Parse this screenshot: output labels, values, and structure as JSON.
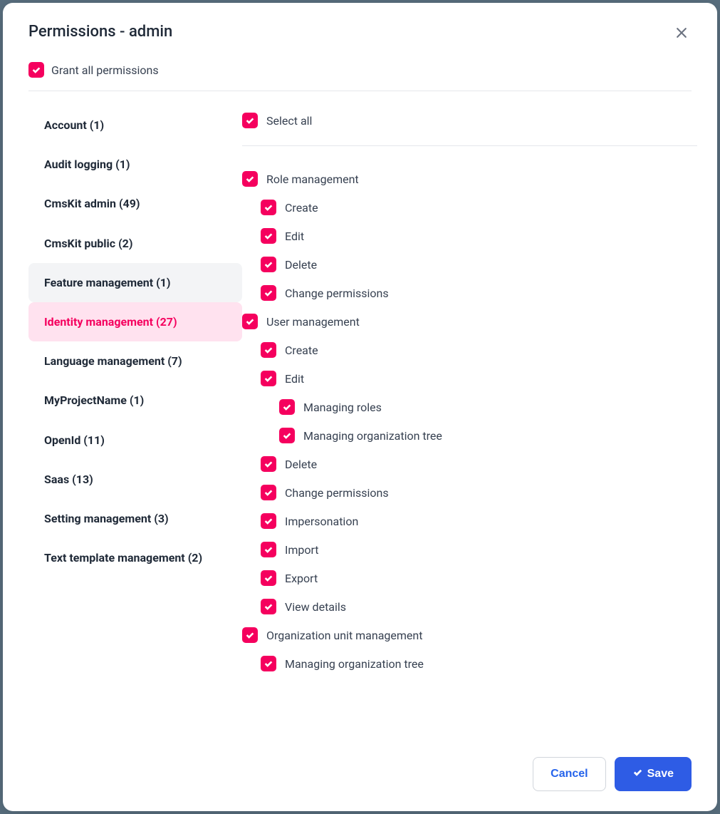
{
  "modal": {
    "title": "Permissions - admin",
    "grant_all_label": "Grant all permissions"
  },
  "sidebar": {
    "items": [
      {
        "label": "Account (1)"
      },
      {
        "label": "Audit logging (1)"
      },
      {
        "label": "CmsKit admin (49)"
      },
      {
        "label": "CmsKit public (2)"
      },
      {
        "label": "Feature management (1)"
      },
      {
        "label": "Identity management (27)"
      },
      {
        "label": "Language management (7)"
      },
      {
        "label": "MyProjectName (1)"
      },
      {
        "label": "OpenId (11)"
      },
      {
        "label": "Saas (13)"
      },
      {
        "label": "Setting management (3)"
      },
      {
        "label": "Text template management (2)"
      }
    ]
  },
  "content": {
    "select_all_label": "Select all",
    "permissions": [
      {
        "label": "Role management",
        "depth": 0
      },
      {
        "label": "Create",
        "depth": 1
      },
      {
        "label": "Edit",
        "depth": 1
      },
      {
        "label": "Delete",
        "depth": 1
      },
      {
        "label": "Change permissions",
        "depth": 1
      },
      {
        "label": "User management",
        "depth": 0
      },
      {
        "label": "Create",
        "depth": 1
      },
      {
        "label": "Edit",
        "depth": 1
      },
      {
        "label": "Managing roles",
        "depth": 2
      },
      {
        "label": "Managing organization tree",
        "depth": 2
      },
      {
        "label": "Delete",
        "depth": 1
      },
      {
        "label": "Change permissions",
        "depth": 1
      },
      {
        "label": "Impersonation",
        "depth": 1
      },
      {
        "label": "Import",
        "depth": 1
      },
      {
        "label": "Export",
        "depth": 1
      },
      {
        "label": "View details",
        "depth": 1
      },
      {
        "label": "Organization unit management",
        "depth": 0
      },
      {
        "label": "Managing organization tree",
        "depth": 1
      }
    ]
  },
  "footer": {
    "cancel_label": "Cancel",
    "save_label": "Save"
  }
}
